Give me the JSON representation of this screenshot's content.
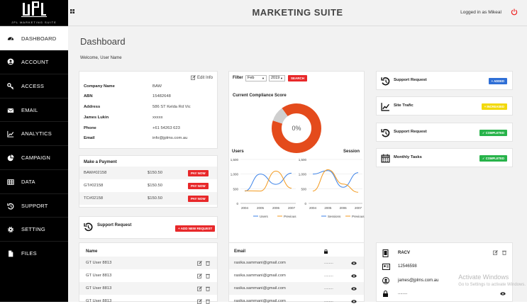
{
  "app": {
    "title": "MARKETING SUITE",
    "logged_in": "Logged in as Mikeal",
    "logo_text": "JPL MARKETING SUITE"
  },
  "sidebar": {
    "items": [
      {
        "label": "DASHBOARD",
        "icon": "dashboard-icon",
        "active": true
      },
      {
        "label": "ACCOUNT",
        "icon": "user-circle-icon"
      },
      {
        "label": "ACCESS",
        "icon": "key-icon"
      },
      {
        "label": "EMAIL",
        "icon": "envelope-icon"
      },
      {
        "label": "ANALYTICS",
        "icon": "line-chart-icon"
      },
      {
        "label": "CAMPAIGN",
        "icon": "pie-chart-icon"
      },
      {
        "label": "DATA",
        "icon": "table-icon"
      },
      {
        "label": "SUPPORT",
        "icon": "history-icon"
      },
      {
        "label": "SETTING",
        "icon": "cog-icon"
      },
      {
        "label": "FILES",
        "icon": "file-icon"
      }
    ]
  },
  "page": {
    "title": "Dashboard",
    "welcome": "Welcome, User Name"
  },
  "info": {
    "edit_label": "Edit Info",
    "fields": [
      {
        "label": "Company Name",
        "value": "BAW"
      },
      {
        "label": "ABN",
        "value": "15482648"
      },
      {
        "label": "Address",
        "value": "586 ST Kelda Rd Vic"
      },
      {
        "label": "James Lukin",
        "value": "xxxxx"
      },
      {
        "label": "Phone",
        "value": "+61 54263 623"
      },
      {
        "label": "Email",
        "value": "info@jplms.com.au"
      }
    ]
  },
  "payment": {
    "title": "Make a Payment",
    "button": "PAY NOW",
    "rows": [
      {
        "ref": "BAW#02158",
        "amount": "$150.50"
      },
      {
        "ref": "GT#02158",
        "amount": "$150.50"
      },
      {
        "ref": "TC#02158",
        "amount": "$150.50"
      }
    ]
  },
  "support_left": {
    "title": "Support Request",
    "button": "+ ADD NEW REQUEST"
  },
  "filter": {
    "label": "Filter",
    "month": "Feb",
    "year": "2019",
    "button": "SEARCH"
  },
  "compliance": {
    "title": "Current Compliance Score",
    "value": "0%",
    "colors": {
      "main": "#e44b1c",
      "rest": "#cfcfcf"
    }
  },
  "chart_data": [
    {
      "type": "pie",
      "title": "Current Compliance Score",
      "values": [
        90,
        10
      ],
      "colors": [
        "#e44b1c",
        "#cfcfcf"
      ],
      "center_label": "0%"
    },
    {
      "type": "line",
      "title": "Users",
      "categories": [
        "2004",
        "2005",
        "2006",
        "2007"
      ],
      "ylim": [
        0,
        1500
      ],
      "yticks": [
        "0",
        "500",
        "1,000",
        "1,500"
      ],
      "series": [
        {
          "name": "Users",
          "values": [
            420,
            1000,
            650,
            1030
          ],
          "color": "#3b82e8"
        },
        {
          "name": "Previous",
          "values": [
            430,
            420,
            1100,
            520
          ],
          "color": "#f39a1f"
        }
      ],
      "legend": "bottom"
    },
    {
      "type": "line",
      "title": "Session",
      "categories": [
        "2004",
        "2005",
        "2006",
        "2007"
      ],
      "ylim": [
        0,
        1500
      ],
      "yticks": [
        "0",
        "500",
        "1,000",
        "1,500"
      ],
      "series": [
        {
          "name": "Sessions",
          "values": [
            1000,
            1120,
            550,
            1050
          ],
          "color": "#3b82e8"
        },
        {
          "name": "Previous",
          "values": [
            420,
            1150,
            660,
            380
          ],
          "color": "#f39a1f"
        }
      ],
      "legend": "bottom"
    }
  ],
  "right_panel": [
    {
      "label": "Support Request",
      "badge": "+ ADDED",
      "color": "#2f6fd6",
      "icon": "history-icon"
    },
    {
      "label": "Site Trafic",
      "badge": "+ INCREASED",
      "color": "#f2d90c",
      "icon": "line-chart-icon"
    },
    {
      "label": "Support Request",
      "badge": "✓ COMPLETED",
      "color": "#27b34a",
      "icon": "history-icon"
    },
    {
      "label": "Monthly Tasks",
      "badge": "✓ COMPLETED",
      "color": "#27b34a",
      "icon": "calendar-icon"
    }
  ],
  "names_table": {
    "header": "Name",
    "rows": [
      "GT User 8813",
      "GT User 8813",
      "GT User 8813",
      "GT User 8813"
    ]
  },
  "email_table": {
    "header": "Email",
    "rows": [
      {
        "email": "rasika.sammani@gmail.com",
        "pw": "........"
      },
      {
        "email": "rasika.sammani@gmail.com",
        "pw": "........"
      },
      {
        "email": "rasika.sammani@gmail.com",
        "pw": "........"
      },
      {
        "email": "rasika.sammani@gmail.com",
        "pw": "........"
      }
    ]
  },
  "contact": {
    "name": "RACV",
    "phone": "12546598",
    "email": "james@jplms.com.au",
    "pw": "........"
  },
  "watermark": {
    "line1": "Activate Windows",
    "line2": "Go to Settings to activate Windows."
  }
}
